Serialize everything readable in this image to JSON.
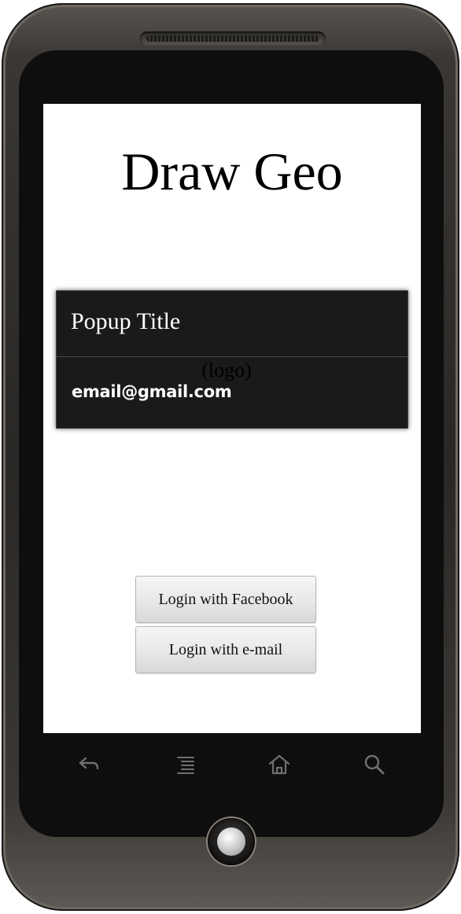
{
  "app": {
    "title": "Draw Geo"
  },
  "popup": {
    "title": "Popup Title",
    "logo_placeholder": "(logo)",
    "email": "email@gmail.com"
  },
  "buttons": {
    "facebook_label": "Login with Facebook",
    "email_label": "Login with e-mail"
  },
  "softkeys": [
    {
      "icon": "back-icon"
    },
    {
      "icon": "menu-icon"
    },
    {
      "icon": "home-icon"
    },
    {
      "icon": "search-icon"
    }
  ],
  "colors": {
    "screen_background": "#ffffff",
    "popup_background": "#1a1a1a",
    "popup_text": "#ffffff",
    "button_background": "#e9e9e9"
  }
}
